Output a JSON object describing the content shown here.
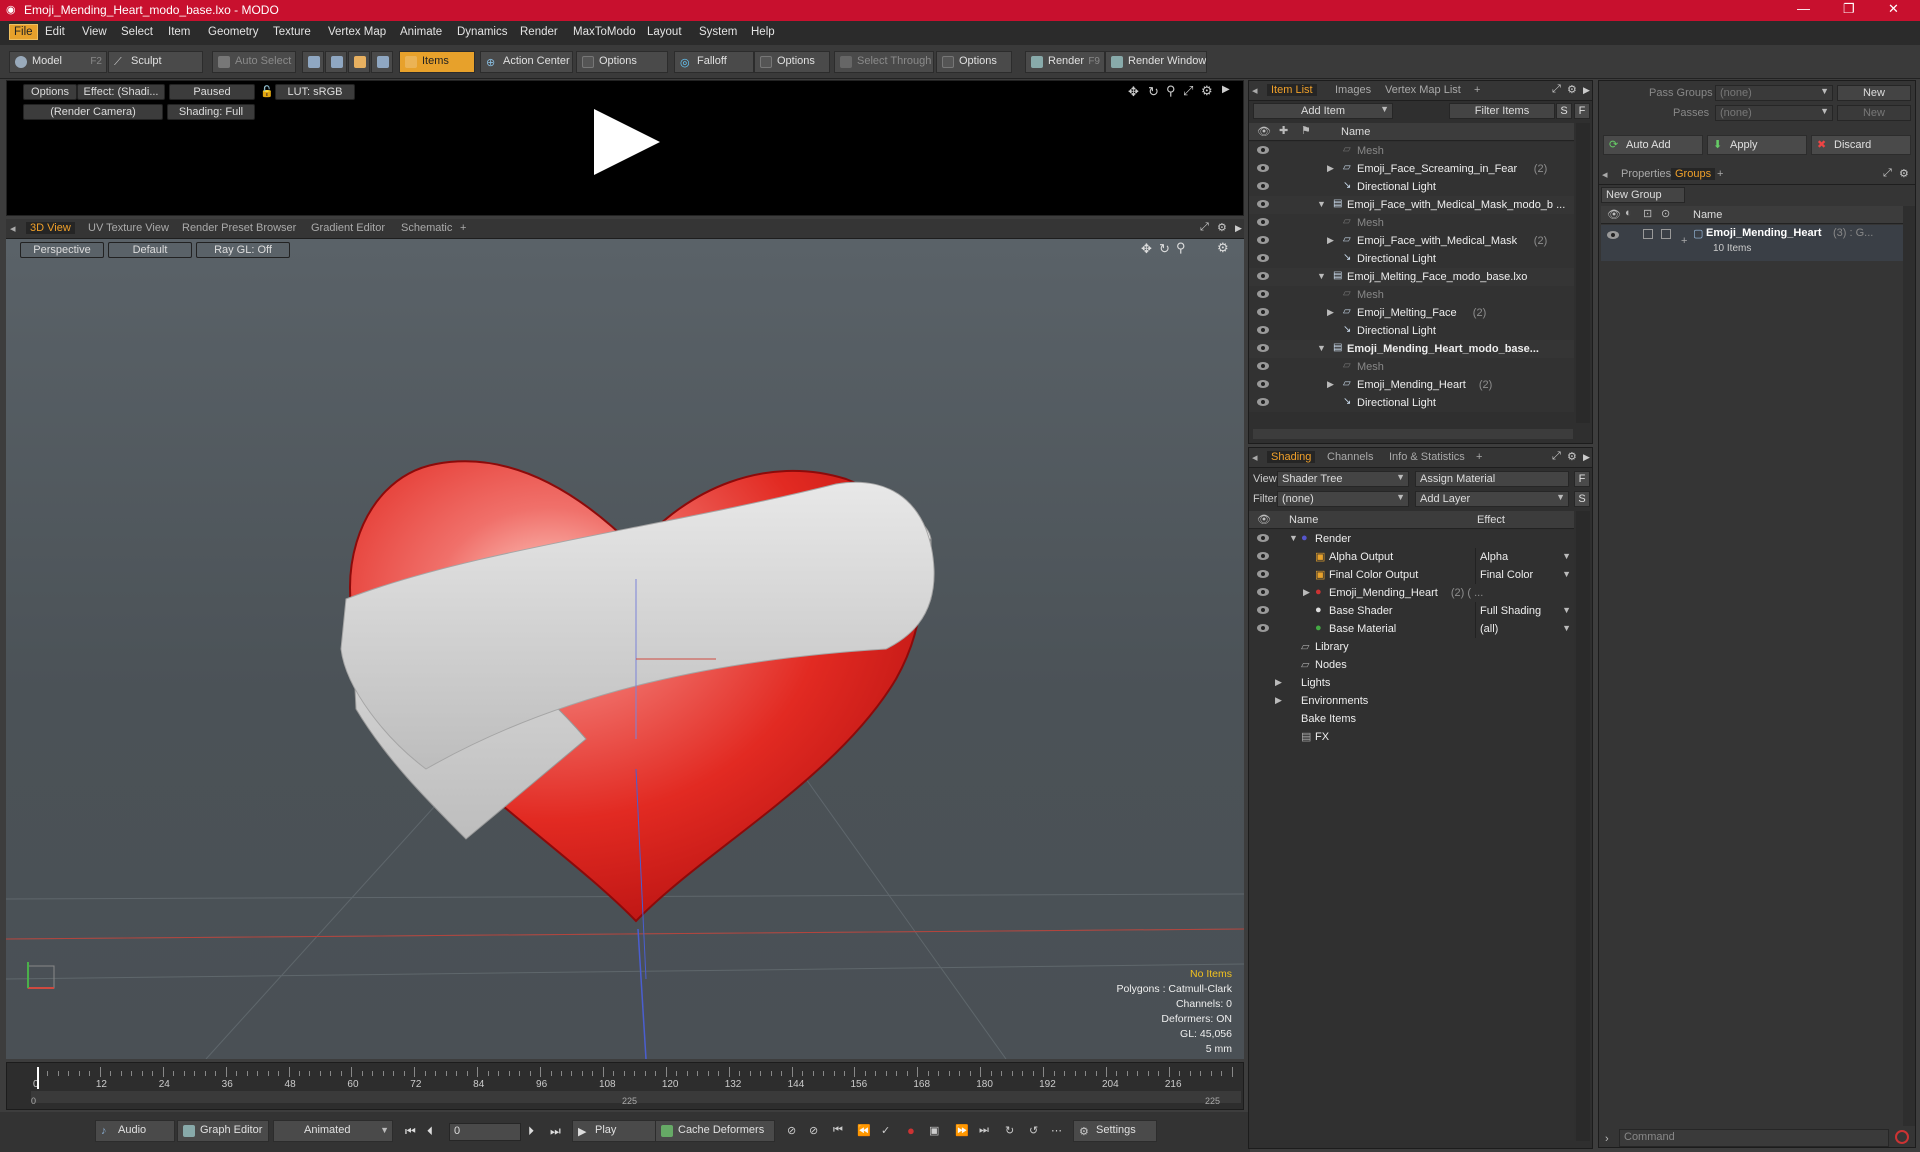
{
  "window": {
    "title": "Emoji_Mending_Heart_modo_base.lxo - MODO",
    "min": "—",
    "max": "❐",
    "close": "✕"
  },
  "menu": [
    "File",
    "Edit",
    "View",
    "Select",
    "Item",
    "Geometry",
    "Texture",
    "Vertex Map",
    "Animate",
    "Dynamics",
    "Render",
    "MaxToModo",
    "Layout",
    "System",
    "Help"
  ],
  "toolbar": {
    "model": "Model",
    "model_key": "F2",
    "sculpt": "Sculpt",
    "auto_select": "Auto Select",
    "items": "Items",
    "action_center": "Action Center",
    "options1": "Options",
    "falloff": "Falloff",
    "options2": "Options",
    "select_through": "Select Through",
    "options3": "Options",
    "render": "Render",
    "render_key": "F9",
    "render_window": "Render Window"
  },
  "preview": {
    "options": "Options",
    "effect": "Effect: (Shadi...",
    "paused": "Paused",
    "lut": "LUT: sRGB",
    "camera": "(Render Camera)",
    "shading": "Shading: Full"
  },
  "viewport": {
    "tabs": [
      "3D View",
      "UV Texture View",
      "Render Preset Browser",
      "Gradient Editor",
      "Schematic",
      "+"
    ],
    "perspective": "Perspective",
    "default": "Default",
    "raygl": "Ray GL: Off",
    "stats": {
      "items": "No Items",
      "polygons": "Polygons : Catmull-Clark",
      "channels": "Channels: 0",
      "deformers": "Deformers: ON",
      "gl": "GL: 45,056",
      "scale": "5 mm"
    }
  },
  "timeline": {
    "ticks": [
      "0",
      "12",
      "24",
      "36",
      "48",
      "60",
      "72",
      "84",
      "96",
      "108",
      "120",
      "132",
      "144",
      "156",
      "168",
      "180",
      "192",
      "204",
      "216"
    ],
    "start": "0",
    "mid": "225",
    "end": "225"
  },
  "transport": {
    "audio": "Audio",
    "graph": "Graph Editor",
    "animated": "Animated",
    "frame": "0",
    "play": "Play",
    "cache": "Cache Deformers",
    "settings": "Settings"
  },
  "itemlist": {
    "tabs": [
      "Item List",
      "Images",
      "Vertex Map List",
      "+"
    ],
    "add_item": "Add Item",
    "filter": "Filter Items",
    "s": "S",
    "f": "F",
    "col_name": "Name",
    "rows": [
      {
        "t": "Mesh",
        "d": 3,
        "g": true
      },
      {
        "t": "Emoji_Face_Screaming_in_Fear",
        "c": "(2)",
        "d": 3,
        "exp": "▶"
      },
      {
        "t": "Directional Light",
        "d": 3
      },
      {
        "t": "Emoji_Face_with_Medical_Mask_modo_b ...",
        "d": 2,
        "exp": "▼"
      },
      {
        "t": "Mesh",
        "d": 3,
        "g": true
      },
      {
        "t": "Emoji_Face_with_Medical_Mask",
        "c": "(2)",
        "d": 3,
        "exp": "▶"
      },
      {
        "t": "Directional Light",
        "d": 3
      },
      {
        "t": "Emoji_Melting_Face_modo_base.lxo",
        "d": 2,
        "exp": "▼"
      },
      {
        "t": "Mesh",
        "d": 3,
        "g": true
      },
      {
        "t": "Emoji_Melting_Face",
        "c": "(2)",
        "d": 3,
        "exp": "▶"
      },
      {
        "t": "Directional Light",
        "d": 3
      },
      {
        "t": "Emoji_Mending_Heart_modo_base...",
        "d": 2,
        "exp": "▼",
        "b": true
      },
      {
        "t": "Mesh",
        "d": 3,
        "g": true
      },
      {
        "t": "Emoji_Mending_Heart",
        "c": "(2)",
        "d": 3,
        "exp": "▶"
      },
      {
        "t": "Directional Light",
        "d": 3
      }
    ]
  },
  "shading": {
    "tabs": [
      "Shading",
      "Channels",
      "Info & Statistics",
      "+"
    ],
    "view_lbl": "View",
    "view": "Shader Tree",
    "assign": "Assign Material",
    "filter_lbl": "Filter",
    "filter": "(none)",
    "add_layer": "Add Layer",
    "col_name": "Name",
    "col_effect": "Effect",
    "rows": [
      {
        "t": "Render",
        "d": 1,
        "exp": "▼"
      },
      {
        "t": "Alpha Output",
        "e": "Alpha",
        "d": 2
      },
      {
        "t": "Final Color Output",
        "e": "Final Color",
        "d": 2
      },
      {
        "t": "Emoji_Mending_Heart",
        "c": "(2) ( ...",
        "d": 2,
        "exp": "▶"
      },
      {
        "t": "Base Shader",
        "e": "Full Shading",
        "d": 2
      },
      {
        "t": "Base Material",
        "e": "(all)",
        "d": 2
      },
      {
        "t": "Library",
        "d": 1
      },
      {
        "t": "Nodes",
        "d": 1
      },
      {
        "t": "Lights",
        "d": 0,
        "exp": "▶"
      },
      {
        "t": "Environments",
        "d": 0,
        "exp": "▶"
      },
      {
        "t": "Bake Items",
        "d": 0
      },
      {
        "t": "FX",
        "d": 1
      }
    ]
  },
  "groups": {
    "pass_groups": "Pass Groups",
    "passes": "Passes",
    "none": "(none)",
    "new": "New",
    "auto_add": "Auto Add",
    "apply": "Apply",
    "discard": "Discard",
    "tabs": [
      "Properties",
      "Groups",
      "+"
    ],
    "new_group": "New Group",
    "col_name": "Name",
    "item": "Emoji_Mending_Heart",
    "item_c": "(3) : G...",
    "item_sub": "10 Items"
  },
  "command": {
    "placeholder": "Command"
  },
  "colors": {
    "title": "#c8102e",
    "accent": "#e7a12b",
    "heart": "#e0201c"
  }
}
